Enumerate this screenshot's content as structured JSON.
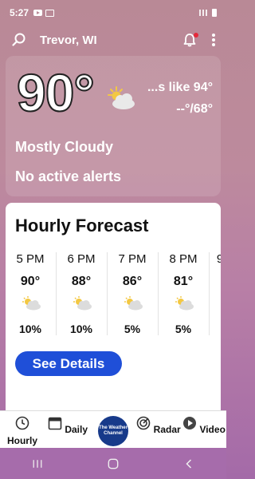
{
  "status_bar": {
    "time": "5:27"
  },
  "header": {
    "location": "Trevor, WI"
  },
  "current": {
    "temperature": "90°",
    "feels_like": "...s like 94°",
    "hi_lo": "--°/68°",
    "condition": "Mostly Cloudy",
    "alerts": "No active alerts"
  },
  "hourly": {
    "title": "Hourly Forecast",
    "items": [
      {
        "time": "5 PM",
        "temp": "90°",
        "precip": "10%",
        "icon": "partly-cloudy-icon"
      },
      {
        "time": "6 PM",
        "temp": "88°",
        "precip": "10%",
        "icon": "partly-cloudy-icon"
      },
      {
        "time": "7 PM",
        "temp": "86°",
        "precip": "5%",
        "icon": "partly-cloudy-icon"
      },
      {
        "time": "8 PM",
        "temp": "81°",
        "precip": "5%",
        "icon": "partly-cloudy-icon"
      },
      {
        "time": "9",
        "temp": "",
        "precip": "",
        "icon": ""
      }
    ],
    "details_button": "See Details"
  },
  "bottom_nav": {
    "hourly": "Hourly",
    "daily": "Daily",
    "brand": "The Weather Channel",
    "radar": "Radar",
    "video": "Video"
  },
  "colors": {
    "accent": "#1f4fd8",
    "background_top": "#b98996",
    "background_bottom": "#a46aa8",
    "alert_dot": "#e5283a"
  }
}
